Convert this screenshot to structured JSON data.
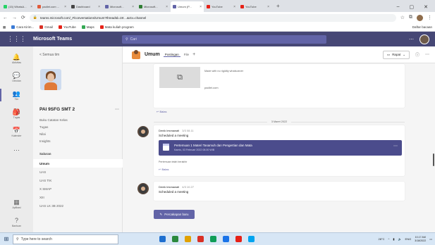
{
  "browser": {
    "tabs": [
      {
        "label": "(15) WhatsA...",
        "color": "#25d366"
      },
      {
        "label": "padlet.com ...",
        "color": "#e05a3a"
      },
      {
        "label": "Dashboard",
        "color": "#444444"
      },
      {
        "label": "Microsoft...",
        "color": "#6264a7"
      },
      {
        "label": "Microsoft...",
        "color": "#2e7d32"
      },
      {
        "label": "Umum (P...",
        "color": "#6264a7",
        "active": true
      },
      {
        "label": "YouTube",
        "color": "#e62117"
      },
      {
        "label": "YouTube",
        "color": "#e62117"
      }
    ],
    "url": "teams.microsoft.com/_#/conversations/Umum?threadId=19:...&ctx=channel",
    "bookmarks": [
      {
        "label": "Cara Kirim...",
        "color": "#3b7bd6"
      },
      {
        "label": "Gmail",
        "color": "#d93025"
      },
      {
        "label": "YouTube",
        "color": "#e62117"
      },
      {
        "label": "Maps",
        "color": "#34a853"
      },
      {
        "label": "Mata kuliah program",
        "color": "#e62117"
      }
    ],
    "bookmarks_right": "Daftar bacaan"
  },
  "teams": {
    "app_name": "Microsoft Teams",
    "search_placeholder": "Cari"
  },
  "rail": {
    "items": [
      {
        "label": "Aktivitas",
        "icon": "🔔",
        "name": "activity"
      },
      {
        "label": "Obrolan",
        "icon": "💬",
        "name": "chat"
      },
      {
        "label": "Tim",
        "icon": "👥",
        "name": "teams",
        "active": true
      },
      {
        "label": "Tugas",
        "icon": "🎒",
        "name": "assignments"
      },
      {
        "label": "Kalender",
        "icon": "📅",
        "name": "calendar"
      },
      {
        "label": "",
        "icon": "⋯",
        "name": "more"
      }
    ],
    "bottom": [
      {
        "label": "Aplikasi",
        "icon": "▦",
        "name": "apps"
      },
      {
        "label": "Bantuan",
        "icon": "?",
        "name": "help"
      }
    ]
  },
  "panel": {
    "back_label": "< Semua tim",
    "team_name": "PAI 9SFG SMT 2",
    "more": "⋯",
    "links": [
      "Buku Catatan Kelas",
      "Tugas",
      "Nilai",
      "Insights"
    ],
    "section_label": "Saluran",
    "channels": [
      {
        "label": "Umum",
        "active": true
      },
      {
        "label": "UAS"
      },
      {
        "label": "UAS TIK"
      },
      {
        "label": "X SMAP"
      },
      {
        "label": "XIII"
      },
      {
        "label": "UAS LK 3B 2022"
      }
    ]
  },
  "channel": {
    "title": "Umum",
    "tabs": [
      "Postingan",
      "File"
    ],
    "add": "+",
    "meet_label": "Rapat",
    "link_card": {
      "desc": "Made with no rigidity whatsoever",
      "host": "padlet.com",
      "reply": "↩ Balas"
    },
    "date_separator": "3 Maret 2022",
    "message1": {
      "author": "Denik lesmawati",
      "time": "3/3 08.11",
      "text": "Scheduled a meeting",
      "meeting_title": "Pertemuan 1 Materi Tasamuh dan Pengertian dan Mata",
      "meeting_sub": "Kamis, 03 Februari 2022 08.00 WIB",
      "ended": "Pertemuan telah berakhir",
      "reply": "↩ Balas"
    },
    "message2": {
      "author": "Denik lesmawati",
      "time": "4/3 10.27",
      "text": "Scheduled a meeting"
    },
    "new_conversation": "Percakapan baru"
  },
  "taskbar": {
    "search_placeholder": "Type here to search",
    "apps": [
      "#1e6fcf",
      "#2b8a3e",
      "#e1a100",
      "#d93025",
      "#0f9d58",
      "#1a73e8",
      "#e62117",
      "#00a4ef"
    ],
    "temperature": "28°C",
    "language": "ENG",
    "time": "10.17 AM",
    "date": "3/18/2022"
  }
}
